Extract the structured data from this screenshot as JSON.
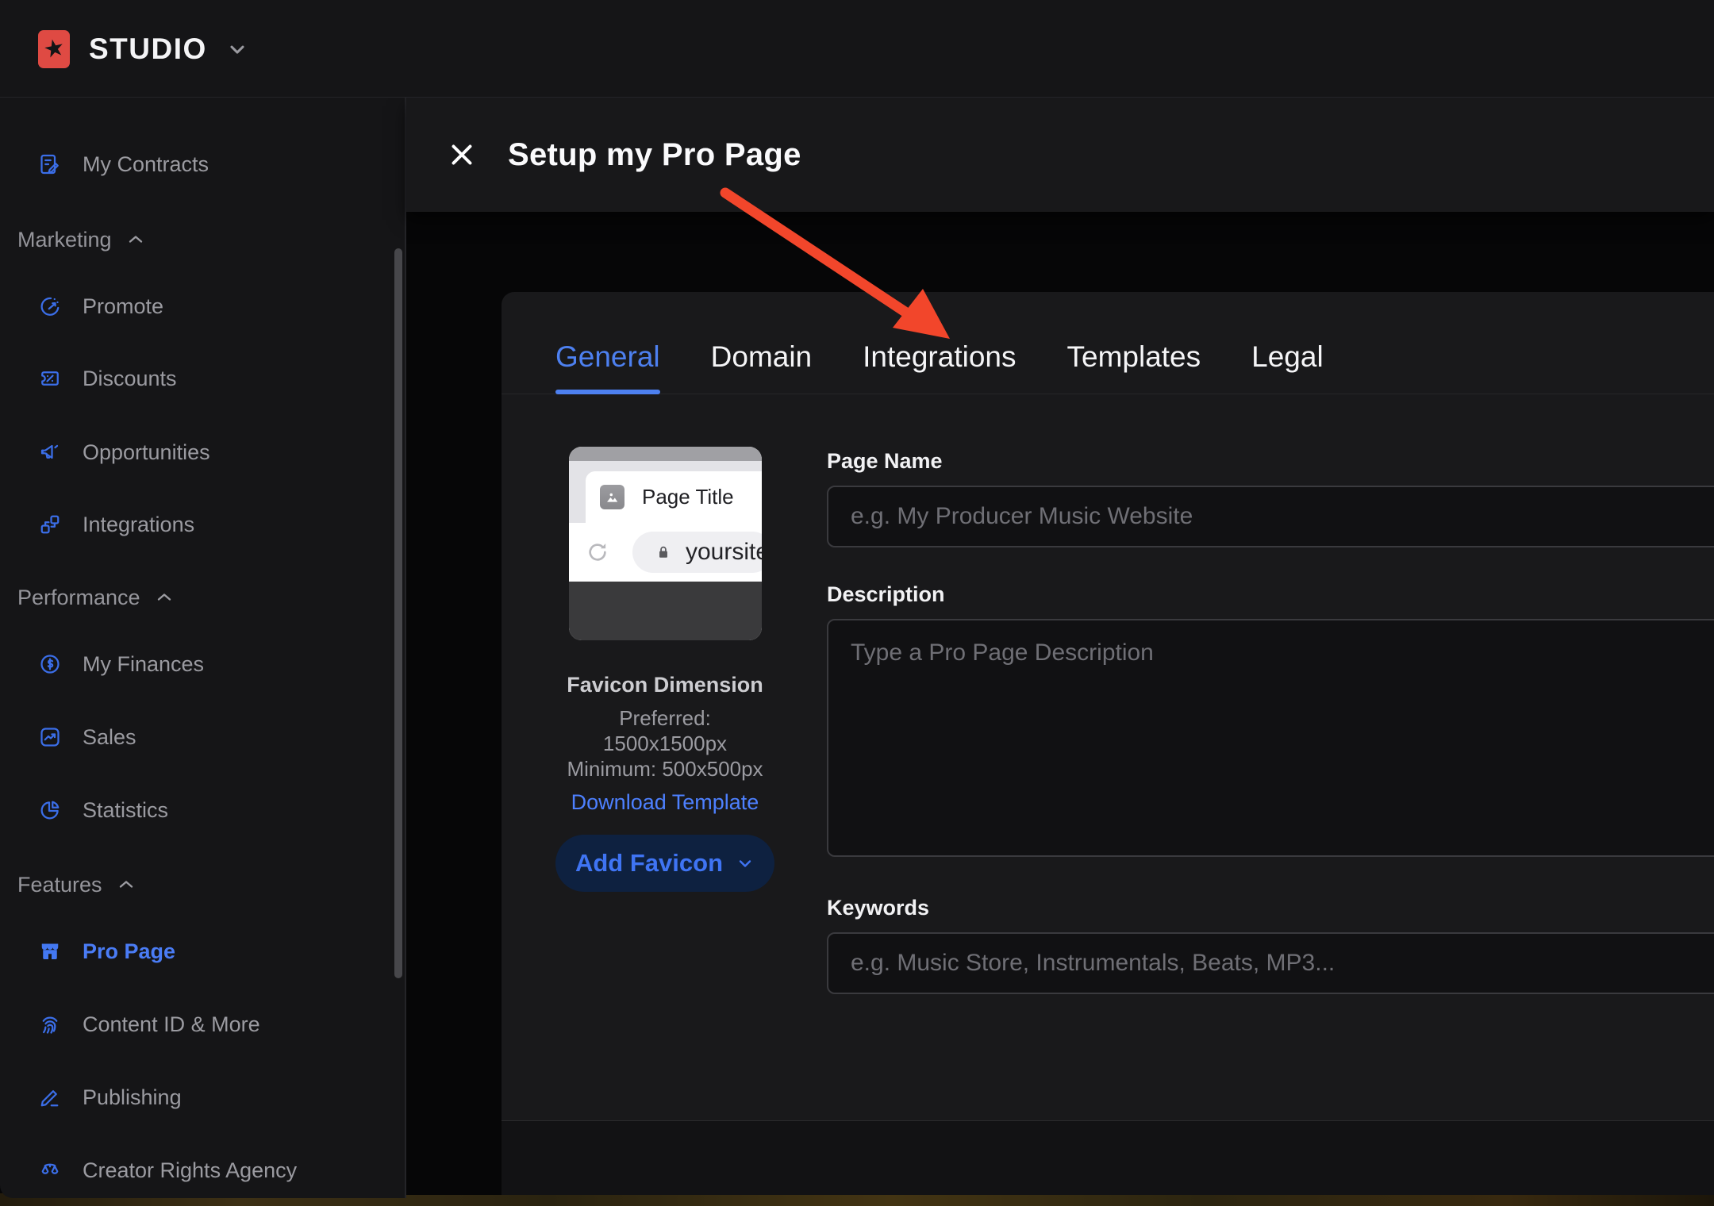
{
  "app": {
    "brand": "STUDIO"
  },
  "sidebar": {
    "items": [
      {
        "label": "My Contracts",
        "icon": "contract-icon",
        "type": "link"
      },
      {
        "label": "Marketing",
        "icon": "chevron-up-icon",
        "type": "section"
      },
      {
        "label": "Promote",
        "icon": "promote-gauge-icon",
        "type": "link"
      },
      {
        "label": "Discounts",
        "icon": "discount-ticket-icon",
        "type": "link"
      },
      {
        "label": "Opportunities",
        "icon": "megaphone-icon",
        "type": "link"
      },
      {
        "label": "Integrations",
        "icon": "blocks-icon",
        "type": "link"
      },
      {
        "label": "Performance",
        "icon": "chevron-up-icon",
        "type": "section"
      },
      {
        "label": "My Finances",
        "icon": "dollar-circle-icon",
        "type": "link"
      },
      {
        "label": "Sales",
        "icon": "sales-chart-icon",
        "type": "link"
      },
      {
        "label": "Statistics",
        "icon": "pie-chart-icon",
        "type": "link"
      },
      {
        "label": "Features",
        "icon": "chevron-up-icon",
        "type": "section"
      },
      {
        "label": "Pro Page",
        "icon": "storefront-icon",
        "type": "link",
        "active": true
      },
      {
        "label": "Content ID & More",
        "icon": "fingerprint-icon",
        "type": "link"
      },
      {
        "label": "Publishing",
        "icon": "pen-icon",
        "type": "link"
      },
      {
        "label": "Creator Rights Agency",
        "icon": "scales-icon",
        "type": "link"
      }
    ]
  },
  "modal": {
    "title": "Setup my Pro Page",
    "tabs": [
      {
        "label": "General",
        "active": true
      },
      {
        "label": "Domain"
      },
      {
        "label": "Integrations"
      },
      {
        "label": "Templates"
      },
      {
        "label": "Legal"
      }
    ],
    "preview": {
      "page_title": "Page Title",
      "url_text": "yoursite"
    },
    "favicon": {
      "heading": "Favicon Dimension",
      "preferred_label": "Preferred:",
      "preferred_value": "1500x1500px",
      "minimum": "Minimum: 500x500px",
      "download_link": "Download Template",
      "add_button": "Add Favicon"
    },
    "form": {
      "page_name": {
        "label": "Page Name",
        "placeholder": "e.g. My Producer Music Website",
        "value": ""
      },
      "description": {
        "label": "Description",
        "placeholder": "Type a Pro Page Description",
        "value": ""
      },
      "keywords": {
        "label": "Keywords",
        "placeholder": "e.g. Music Store, Instrumentals, Beats, MP3...",
        "value": ""
      }
    }
  },
  "annotation": {
    "arrow_color": "#f2462b",
    "points_to": "Integrations tab"
  },
  "colors": {
    "accent_blue": "#4a7cf5",
    "icon_blue": "#3b6ee8",
    "link_blue": "#4d80ff",
    "brand_red": "#df4a43",
    "panel": "#151517",
    "card": "#19191b",
    "backdrop": "#060607",
    "button_navy": "#0e2140",
    "arrow_red": "#f2462b"
  }
}
